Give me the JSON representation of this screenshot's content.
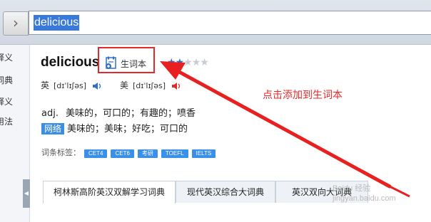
{
  "search": {
    "query": "delicious"
  },
  "nav": {
    "forward_glyph": "›"
  },
  "sidebar": {
    "items": [
      {
        "label": "释义"
      },
      {
        "label": "词典"
      },
      {
        "label": "释义"
      },
      {
        "label": "用法"
      }
    ],
    "toggle_glyph": "◀"
  },
  "entry": {
    "word": "delicious",
    "add_vocab_label": "生词本",
    "rating": {
      "filled": 2,
      "total": 5
    },
    "uk": {
      "label": "英",
      "phonetic": "[dɪˈlɪʃəs]"
    },
    "us": {
      "label": "美",
      "phonetic": "[dɪˈlɪʃəs]"
    },
    "definition": {
      "pos": "adj.",
      "text": "美味的，可口的；有趣的；喷香"
    },
    "web": {
      "tag": "网络",
      "text": "美味的；美味；好吃；可口的"
    },
    "tags_label": "词条标签：",
    "tags": [
      "CET4",
      "CET6",
      "考研",
      "TOEFL",
      "IELTS"
    ]
  },
  "annotation": {
    "text": "点击添加到生词本",
    "color": "#e22a2a"
  },
  "tabs": [
    {
      "label": "柯林斯高阶英汉双解学习词典",
      "active": true
    },
    {
      "label": "现代英汉综合大词典",
      "active": false
    },
    {
      "label": "英汉双向大词典",
      "active": false
    }
  ],
  "watermark": {
    "line1": "Baidu 经验",
    "line2": "jingyan.baidu.com"
  }
}
